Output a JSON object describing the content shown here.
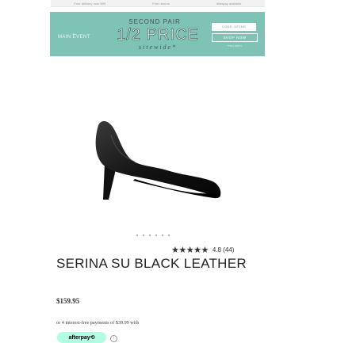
{
  "top_strip": {
    "items": [
      "Free delivery over $99",
      "Free returns",
      "Afterpay available"
    ]
  },
  "banner": {
    "main_event_small": "the",
    "main_event": "MAIN EVENT",
    "second_pair": "SECOND PAIR",
    "half_price": "1/2 PRICE",
    "sitewide": "sitewide*",
    "code": "CODE: DF2ND",
    "shop_now": "SHOP NOW",
    "terms": "*T&Cs APPLY",
    "color": "#7fc3b6"
  },
  "product": {
    "image_icon": "black-pump-shoe",
    "carousel_dots": 6,
    "stars": "★★★★★",
    "rating": "4.8 (44)",
    "title": "SERINA SU BLACK LEATHER",
    "price": "$159.95",
    "installments": "or 4 interest-free payments of $39.99 with",
    "afterpay_label": "afterpay⟲",
    "info_icon": "info-icon"
  }
}
